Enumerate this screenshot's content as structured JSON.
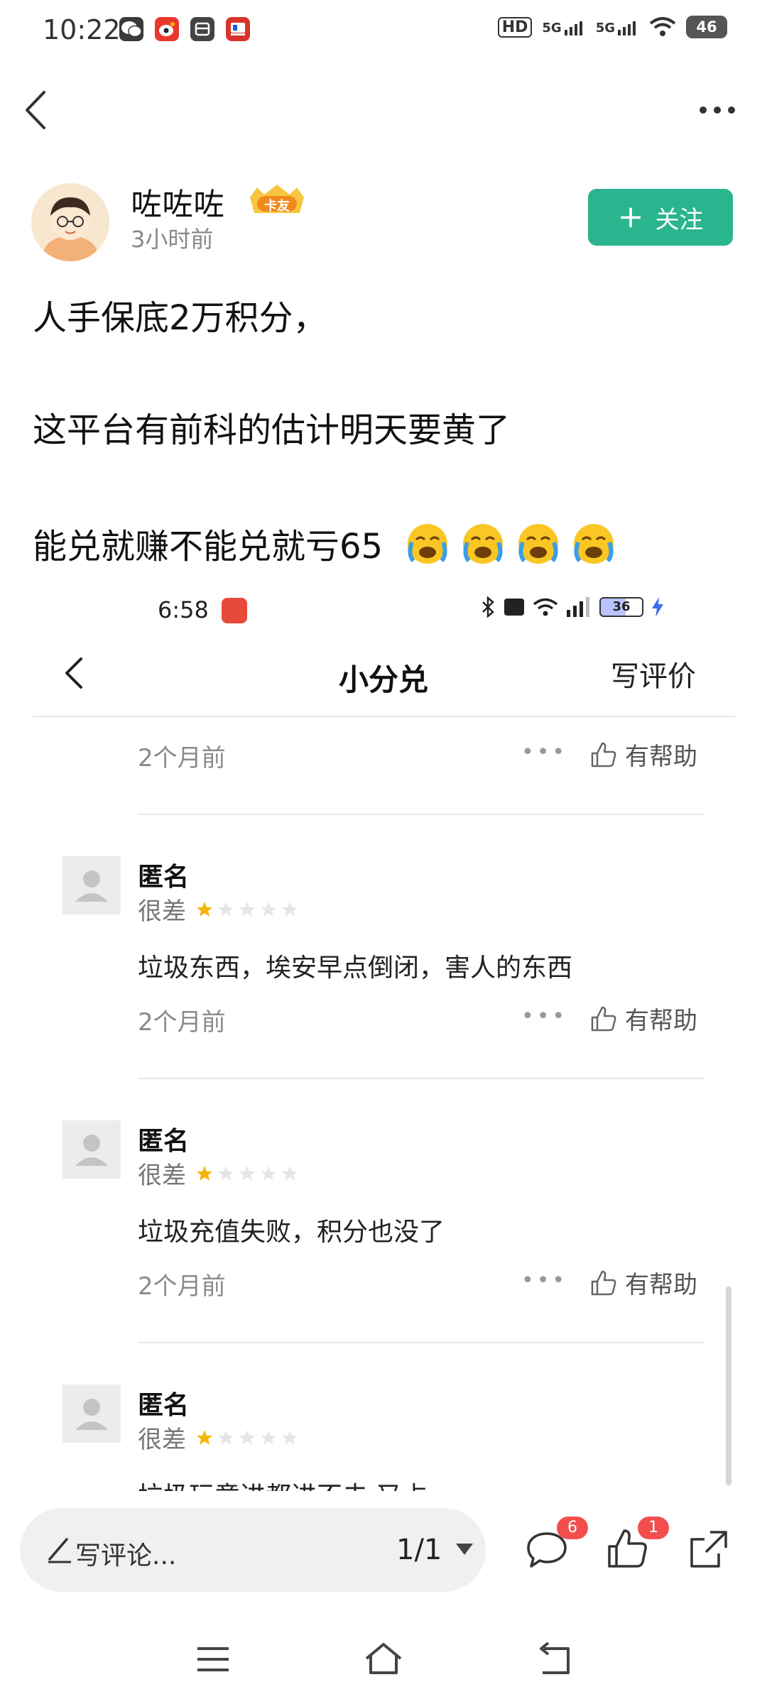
{
  "status_bar": {
    "time": "10:22",
    "network_labels": [
      "HD",
      "5G",
      "5G"
    ],
    "battery": "46"
  },
  "post": {
    "author": "咗咗咗",
    "badge": "卡友",
    "time": "3小时前",
    "follow_label": "关注",
    "lines": [
      "人手保底2万积分，",
      "这平台有前科的估计明天要黄了",
      "能兑就赚不能兑就亏65"
    ],
    "emoji_count": 4
  },
  "embedded": {
    "time": "6:58",
    "battery": "36",
    "title": "小分兑",
    "write_review": "写评价",
    "reviews": [
      {
        "date": "2个月前",
        "help": "有帮助"
      },
      {
        "name": "匿名",
        "rating_label": "很差",
        "stars": 1,
        "text": "垃圾东西，埃安早点倒闭，害人的东西",
        "date": "2个月前",
        "help": "有帮助"
      },
      {
        "name": "匿名",
        "rating_label": "很差",
        "stars": 1,
        "text": "垃圾充值失败，积分也没了",
        "date": "2个月前",
        "help": "有帮助"
      },
      {
        "name": "匿名",
        "rating_label": "很差",
        "stars": 1,
        "text": "垃圾玩意进都进不去 又占"
      }
    ]
  },
  "bottom_bar": {
    "comment_placeholder": "写评论...",
    "page_indicator": "1/1",
    "comment_count": "6",
    "like_count": "1"
  },
  "colors": {
    "accent": "#2ab58e",
    "badge_red": "#f24e4e",
    "star_gold": "#f5b400"
  }
}
